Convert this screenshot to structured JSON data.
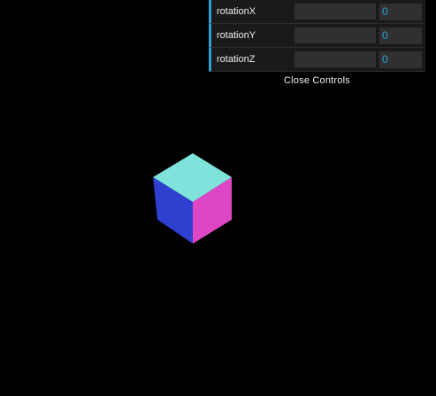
{
  "controls": {
    "rows": [
      {
        "label": "rotationX",
        "value": "0",
        "fraction": 0
      },
      {
        "label": "rotationY",
        "value": "0",
        "fraction": 0
      },
      {
        "label": "rotationZ",
        "value": "0",
        "fraction": 0
      }
    ],
    "close_label": "Close Controls"
  },
  "scene": {
    "background": "#000000",
    "cube_face_top": "#7fe3dc",
    "cube_face_left": "#2f3fd0",
    "cube_face_right": "#df46c6"
  },
  "accent": "#2fa1d6"
}
